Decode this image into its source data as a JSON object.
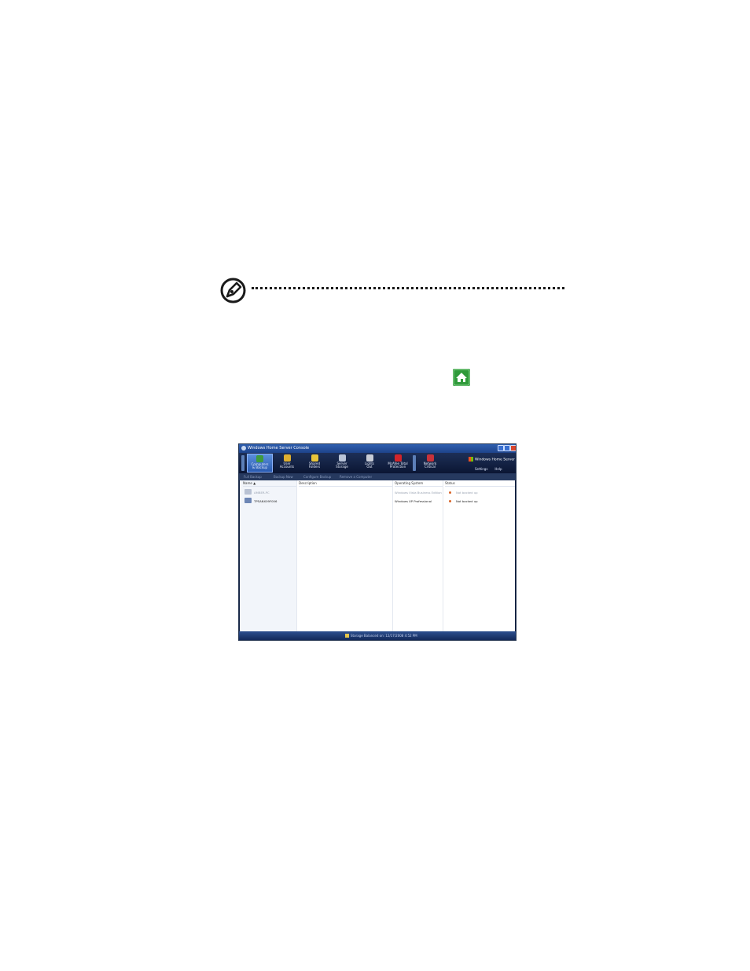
{
  "window": {
    "title": "Windows Home Server Console",
    "brand": "Windows Home Server",
    "nav_items": [
      {
        "line1": "Computers",
        "line2": "& Backup",
        "color": "#3f9b3f"
      },
      {
        "line1": "User",
        "line2": "Accounts",
        "color": "#e0b030"
      },
      {
        "line1": "Shared",
        "line2": "Folders",
        "color": "#e8c43a"
      },
      {
        "line1": "Server",
        "line2": "Storage",
        "color": "#b9c4d8"
      },
      {
        "line1": "Lights",
        "line2": "Out",
        "color": "#c8ccd6"
      },
      {
        "line1": "McAfee Total",
        "line2": "Protection",
        "color": "#d3242a"
      },
      {
        "line1": "Network",
        "line2": "Critical",
        "color": "#c8323a"
      }
    ],
    "nav_links": {
      "settings": "Settings",
      "help": "Help"
    },
    "toolbar": [
      "Full Backup",
      "Backup Now",
      "Configure Backup",
      "Remove a Computer"
    ],
    "columns": [
      "Name",
      "Description",
      "Operating System",
      "Status"
    ],
    "rows": [
      {
        "name": "AMBER-PC",
        "description": "",
        "os": "Windows Vista Business Edition",
        "status": "Not backed up",
        "dim": true
      },
      {
        "name": "TPSANX09F006",
        "description": "",
        "os": "Windows XP Professional",
        "status": "Not backed up",
        "dim": false
      }
    ],
    "status_text": "Storage Balanced on: 12/17/2008 4:52 PM"
  }
}
